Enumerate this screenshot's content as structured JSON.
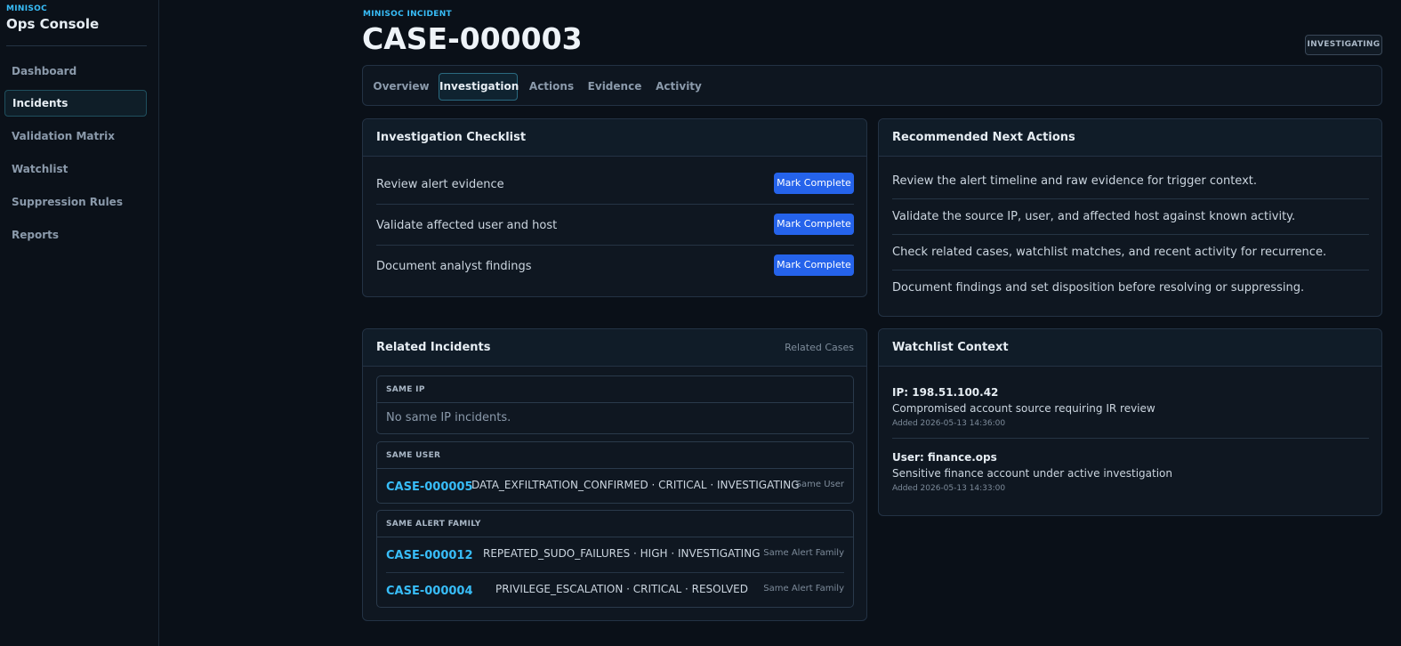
{
  "sidebar": {
    "brand_small": "MINISOC",
    "brand_title": "Ops Console",
    "items": [
      {
        "label": "Dashboard"
      },
      {
        "label": "Incidents"
      },
      {
        "label": "Validation Matrix"
      },
      {
        "label": "Watchlist"
      },
      {
        "label": "Suppression Rules"
      },
      {
        "label": "Reports"
      }
    ],
    "active": "Incidents"
  },
  "header": {
    "kicker": "MINISOC INCIDENT",
    "title": "CASE-000003",
    "status": "INVESTIGATING"
  },
  "tabs": [
    {
      "label": "Overview"
    },
    {
      "label": "Investigation"
    },
    {
      "label": "Actions"
    },
    {
      "label": "Evidence"
    },
    {
      "label": "Activity"
    }
  ],
  "active_tab": "Investigation",
  "checklist": {
    "title": "Investigation Checklist",
    "button_label": "Mark Complete",
    "items": [
      {
        "label": "Review alert evidence"
      },
      {
        "label": "Validate affected user and host"
      },
      {
        "label": "Document analyst findings"
      }
    ]
  },
  "recommended": {
    "title": "Recommended Next Actions",
    "items": [
      "Review the alert timeline and raw evidence for trigger context.",
      "Validate the source IP, user, and affected host against known activity.",
      "Check related cases, watchlist matches, and recent activity for recurrence.",
      "Document findings and set disposition before resolving or suppressing."
    ]
  },
  "related": {
    "title": "Related Incidents",
    "subtitle": "Related Cases",
    "same_ip": {
      "title": "SAME IP",
      "empty": "No same IP incidents."
    },
    "same_user": {
      "title": "SAME USER",
      "items": [
        {
          "case": "CASE-000005",
          "desc": "DATA_EXFILTRATION_CONFIRMED · CRITICAL · INVESTIGATING",
          "tag": "Same User"
        }
      ]
    },
    "same_alert_family": {
      "title": "SAME ALERT FAMILY",
      "items": [
        {
          "case": "CASE-000012",
          "desc": "REPEATED_SUDO_FAILURES · HIGH · INVESTIGATING",
          "tag": "Same Alert Family"
        },
        {
          "case": "CASE-000004",
          "desc": "PRIVILEGE_ESCALATION · CRITICAL · RESOLVED",
          "tag": "Same Alert Family"
        }
      ]
    }
  },
  "watchlist": {
    "title": "Watchlist Context",
    "items": [
      {
        "title": "IP: 198.51.100.42",
        "desc": "Compromised account source requiring IR review",
        "added": "Added 2026-05-13 14:36:00"
      },
      {
        "title": "User: finance.ops",
        "desc": "Sensitive finance account under active investigation",
        "added": "Added 2026-05-13 14:33:00"
      }
    ]
  },
  "colors": {
    "accent": "#38bdf8",
    "button": "#2563eb",
    "background": "#0a1018"
  }
}
